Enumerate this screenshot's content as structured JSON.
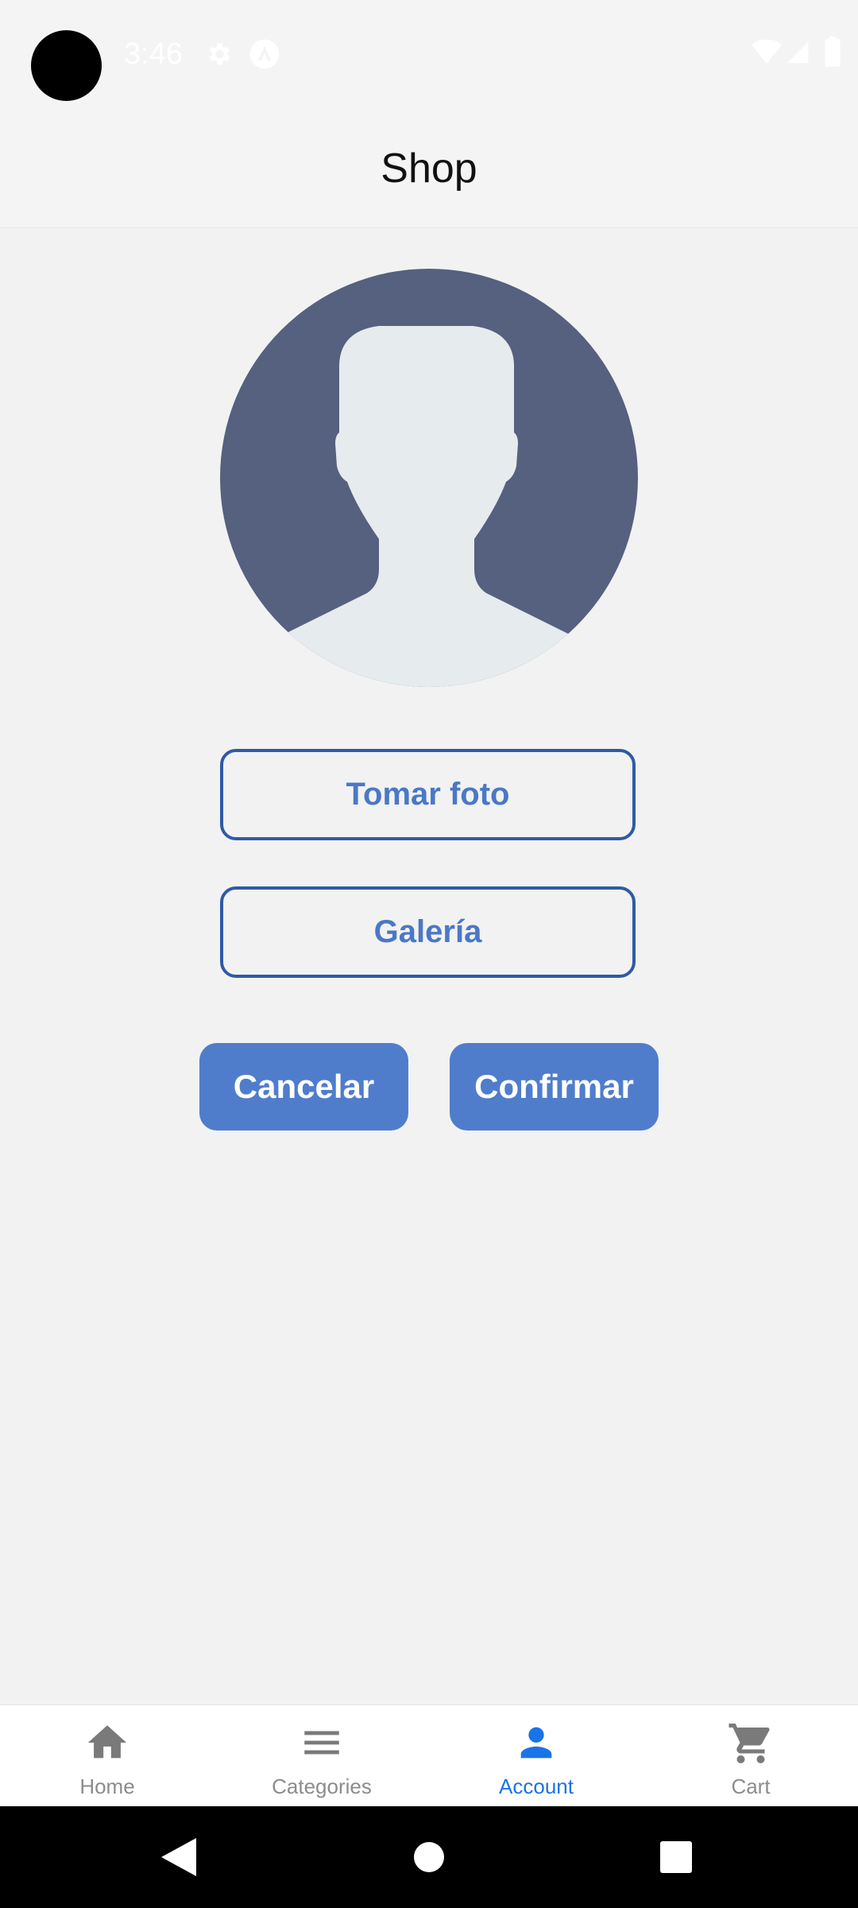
{
  "status_bar": {
    "time": "3:46",
    "left_icons": [
      "settings-icon",
      "app-notification-icon"
    ],
    "right_icons": [
      "wifi-icon",
      "cell-signal-icon",
      "battery-icon"
    ]
  },
  "app_bar": {
    "title": "Shop"
  },
  "profile": {
    "avatar_icon": "default-user-avatar",
    "take_photo_label": "Tomar foto",
    "gallery_label": "Galería",
    "cancel_label": "Cancelar",
    "confirm_label": "Confirmar"
  },
  "bottom_nav": {
    "items": [
      {
        "label": "Home",
        "icon": "home-icon",
        "active": false
      },
      {
        "label": "Categories",
        "icon": "menu-icon",
        "active": false
      },
      {
        "label": "Account",
        "icon": "person-icon",
        "active": true
      },
      {
        "label": "Cart",
        "icon": "cart-icon",
        "active": false
      }
    ]
  },
  "system_nav": {
    "buttons": [
      "back",
      "home",
      "recents"
    ]
  },
  "colors": {
    "accent": "#4f7dcc",
    "outline": "#2f5aa6",
    "active_tab": "#1a73e8",
    "avatar_bg": "#56607f",
    "avatar_fg": "#e6ebee"
  }
}
